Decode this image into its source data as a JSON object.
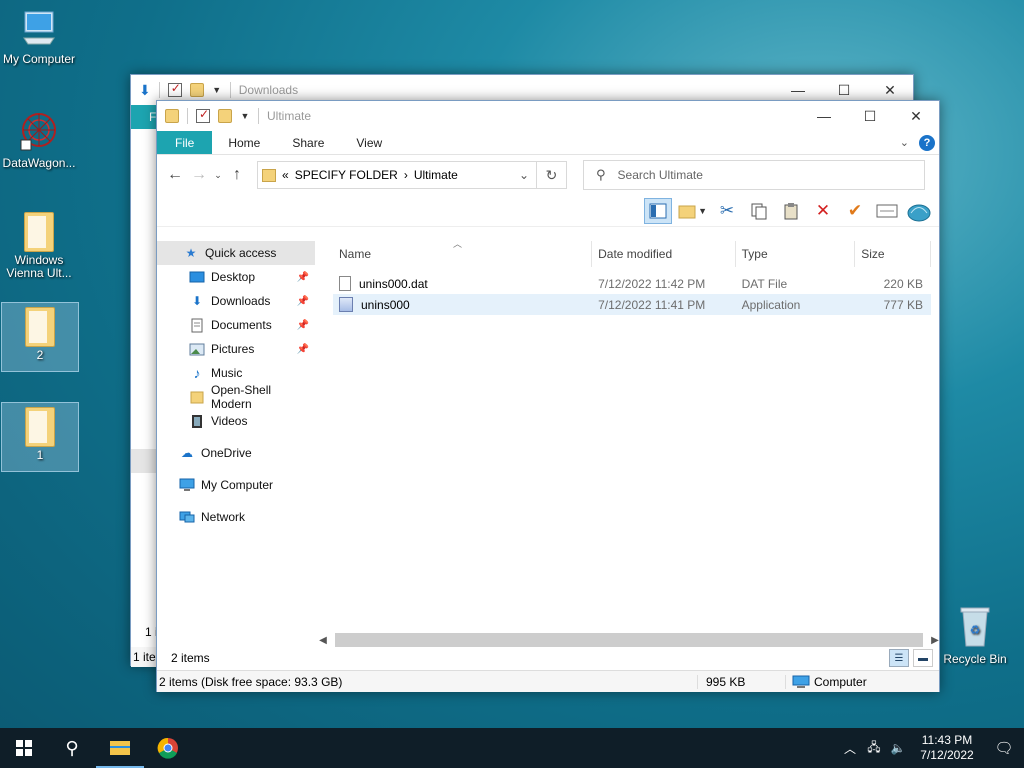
{
  "desktop": {
    "icons": [
      {
        "label": "My Computer"
      },
      {
        "label": "DataWagon..."
      },
      {
        "label": "Windows Vienna Ult..."
      },
      {
        "label": "2"
      },
      {
        "label": "1"
      },
      {
        "label": "Recycle Bin"
      }
    ]
  },
  "back_window": {
    "title": "Downloads",
    "status_count": "1 it",
    "status_left": "1 ite",
    "file_tab": "F"
  },
  "window": {
    "title": "Ultimate",
    "ribbon": {
      "file": "File",
      "home": "Home",
      "share": "Share",
      "view": "View"
    },
    "address": {
      "prefix": "«",
      "crumb1": "SPECIFY FOLDER",
      "sep": "›",
      "crumb2": "Ultimate"
    },
    "search": {
      "placeholder": "Search Ultimate"
    },
    "nav": {
      "quick_access": "Quick access",
      "items": [
        {
          "label": "Desktop",
          "pinned": true
        },
        {
          "label": "Downloads",
          "pinned": true
        },
        {
          "label": "Documents",
          "pinned": true
        },
        {
          "label": "Pictures",
          "pinned": true
        },
        {
          "label": "Music",
          "pinned": false
        },
        {
          "label": "Open-Shell Modern",
          "pinned": false
        },
        {
          "label": "Videos",
          "pinned": false
        }
      ],
      "onedrive": "OneDrive",
      "mycomputer": "My Computer",
      "network": "Network"
    },
    "columns": {
      "name": "Name",
      "date": "Date modified",
      "type": "Type",
      "size": "Size"
    },
    "files": [
      {
        "name": "unins000.dat",
        "date": "7/12/2022 11:42 PM",
        "type": "DAT File",
        "size": "220 KB"
      },
      {
        "name": "unins000",
        "date": "7/12/2022 11:41 PM",
        "type": "Application",
        "size": "777 KB"
      }
    ],
    "item_count": "2 items",
    "status": {
      "left": "2 items (Disk free space: 93.3 GB)",
      "size": "995 KB",
      "location": "Computer"
    }
  },
  "taskbar": {
    "time": "11:43 PM",
    "date": "7/12/2022"
  },
  "colors": {
    "accent": "#1da4b0",
    "selection": "#e5f1fb"
  }
}
